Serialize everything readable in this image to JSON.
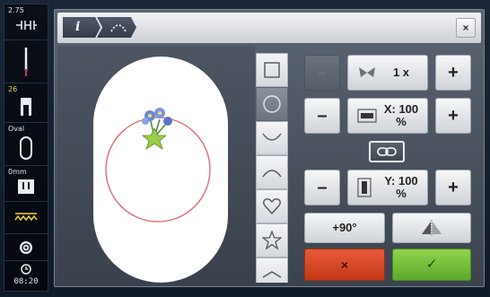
{
  "status_bar": {
    "needle_value": "2.75",
    "presser_foot_number": "26",
    "hoop_label": "Oval",
    "stitch_width": "0mm",
    "time": "08:20"
  },
  "window": {
    "info_tab_label": "i",
    "close_label": "×"
  },
  "controls": {
    "repeat_label": "1 x",
    "minus_label": "–",
    "plus_label": "+",
    "scale_x_label": "X: 100 %",
    "scale_y_label": "Y: 100 %",
    "rotate_label": "+90°",
    "cancel_label": "×",
    "confirm_label": "✓"
  },
  "shapes": [
    "square",
    "circle",
    "arc-down",
    "arc-up",
    "heart",
    "star",
    "more"
  ],
  "selected_shape": "circle",
  "colors": {
    "accent_red": "#d4482a",
    "accent_green": "#6cbb33",
    "circle_line": "#e0606a",
    "status_yellow": "#f0d040"
  }
}
